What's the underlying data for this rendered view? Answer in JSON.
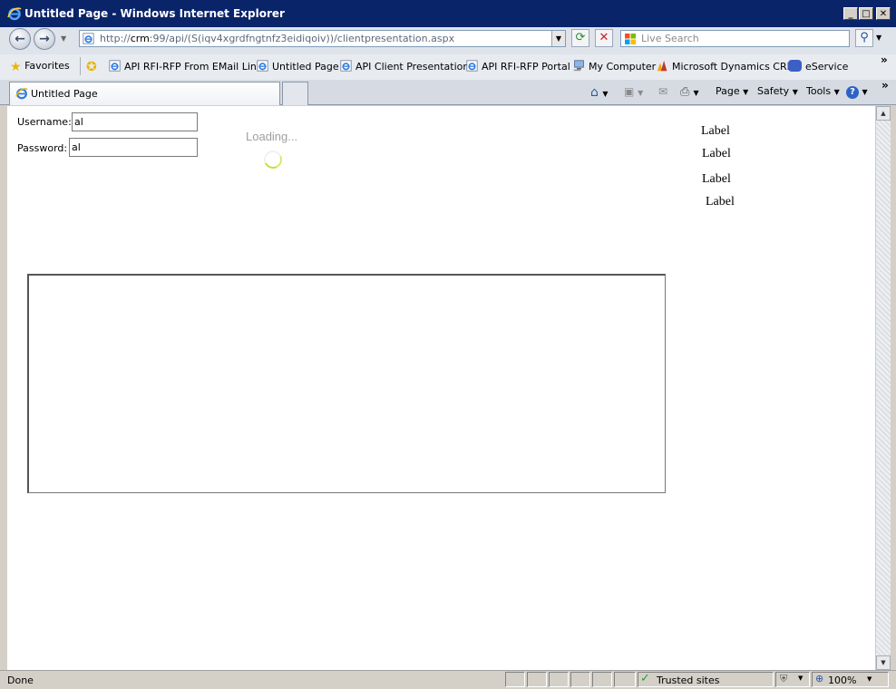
{
  "window": {
    "title": "Untitled Page - Windows Internet Explorer",
    "controls": {
      "minimize": "_",
      "maximize": "□",
      "close": "✕"
    }
  },
  "address_bar": {
    "url_scheme": "http://",
    "url_host": "crm",
    "url_rest": ":99/api/(S(iqv4xgrdfngtnfz3eidiqoiv))/clientpresentation.aspx"
  },
  "search": {
    "placeholder": "Live Search"
  },
  "favorites_bar": {
    "favorites_label": "Favorites",
    "items": [
      {
        "label": "API RFI-RFP From EMail Link"
      },
      {
        "label": "Untitled Page"
      },
      {
        "label": "API Client Presentation"
      },
      {
        "label": "API RFI-RFP Portal"
      },
      {
        "label": "My Computer"
      },
      {
        "label": "Microsoft Dynamics CRM"
      },
      {
        "label": "eService"
      }
    ],
    "overflow": "»"
  },
  "tabs": [
    {
      "label": "Untitled Page"
    }
  ],
  "command_bar": {
    "page": "Page",
    "safety": "Safety",
    "tools": "Tools",
    "overflow": "»"
  },
  "form": {
    "username_label": "Username:",
    "username_value": "al",
    "password_label": "Password:",
    "password_value": "al"
  },
  "loading_text": "Loading...",
  "labels": [
    "Label",
    "Label",
    "Label",
    "Label"
  ],
  "status_bar": {
    "status": "Done",
    "zone": "Trusted sites",
    "zoom": "100%"
  }
}
